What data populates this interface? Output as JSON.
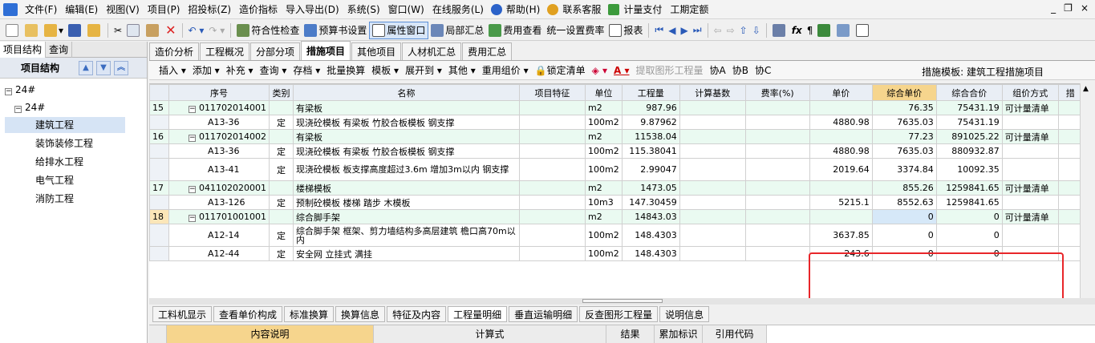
{
  "menu": [
    "文件(F)",
    "编辑(E)",
    "视图(V)",
    "项目(P)",
    "招投标(Z)",
    "造价指标",
    "导入导出(D)",
    "系统(S)",
    "窗口(W)",
    "在线服务(L)",
    "帮助(H)",
    "联系客服",
    "计量支付",
    "工期定额"
  ],
  "window_controls": [
    "_",
    "❐",
    "×"
  ],
  "toolbar": {
    "compliance_check": "符合性检查",
    "budget_settings": "预算书设置",
    "property_window": "属性窗口",
    "partial_summary": "局部汇总",
    "fee_view": "费用查看",
    "unified_rate": "统一设置费率",
    "report": "报表"
  },
  "left_panel": {
    "tabs": [
      "项目结构",
      "查询"
    ],
    "header": "项目结构",
    "tree": [
      {
        "label": "24#",
        "level": 0,
        "box": "−"
      },
      {
        "label": "24#",
        "level": 1,
        "box": "−"
      },
      {
        "label": "建筑工程",
        "level": 2,
        "selected": true
      },
      {
        "label": "装饰装修工程",
        "level": 2
      },
      {
        "label": "给排水工程",
        "level": 2
      },
      {
        "label": "电气工程",
        "level": 2
      },
      {
        "label": "消防工程",
        "level": 2
      }
    ]
  },
  "main_tabs": [
    "造价分析",
    "工程概况",
    "分部分项",
    "措施项目",
    "其他项目",
    "人材机汇总",
    "费用汇总"
  ],
  "active_main_tab": "措施项目",
  "tools": [
    "插入 ▾",
    "添加 ▾",
    "补充 ▾",
    "查询 ▾",
    "存档 ▾",
    "批量换算",
    "模板 ▾",
    "展开到 ▾",
    "其他 ▾",
    "重用组价 ▾",
    "锁定清单",
    "提取图形工程量",
    "协A",
    "协B",
    "协C"
  ],
  "template_label": "措施模板: 建筑工程措施项目",
  "columns": [
    "",
    "序号",
    "类别",
    "名称",
    "项目特征",
    "单位",
    "工程量",
    "计算基数",
    "费率(%)",
    "单价",
    "综合单价",
    "综合合价",
    "组价方式",
    "措"
  ],
  "rows": [
    {
      "rn": "15",
      "code": "011702014001",
      "box": true,
      "type": "",
      "name": "有梁板",
      "unit": "m2",
      "qty": "987.96",
      "price": "",
      "uprice": "76.35",
      "total": "75431.19",
      "method": "可计量清单",
      "parent": true
    },
    {
      "rn": "",
      "code": "A13-36",
      "type": "定",
      "name": "现浇砼模板 有梁板 竹胶合板模板 钢支撑",
      "unit": "100m2",
      "qty": "9.87962",
      "price": "4880.98",
      "uprice": "7635.03",
      "total": "75431.19",
      "method": ""
    },
    {
      "rn": "16",
      "code": "011702014002",
      "box": true,
      "type": "",
      "name": "有梁板",
      "unit": "m2",
      "qty": "11538.04",
      "price": "",
      "uprice": "77.23",
      "total": "891025.22",
      "method": "可计量清单",
      "parent": true
    },
    {
      "rn": "",
      "code": "A13-36",
      "type": "定",
      "name": "现浇砼模板 有梁板 竹胶合板模板 钢支撑",
      "unit": "100m2",
      "qty": "115.38041",
      "price": "4880.98",
      "uprice": "7635.03",
      "total": "880932.87",
      "method": ""
    },
    {
      "rn": "",
      "code": "A13-41",
      "type": "定",
      "name": "现浇砼模板 板支撑高度超过3.6m 增加3m以内 钢支撑",
      "unit": "100m2",
      "qty": "2.99047",
      "price": "2019.64",
      "uprice": "3374.84",
      "total": "10092.35",
      "method": "",
      "tall": true
    },
    {
      "rn": "17",
      "code": "041102020001",
      "box": true,
      "type": "",
      "name": "楼梯模板",
      "unit": "m2",
      "qty": "1473.05",
      "price": "",
      "uprice": "855.26",
      "total": "1259841.65",
      "method": "可计量清单",
      "parent": true
    },
    {
      "rn": "",
      "code": "A13-126",
      "type": "定",
      "name": "预制砼模板 楼梯 踏步 木模板",
      "unit": "10m3",
      "qty": "147.30459",
      "price": "5215.1",
      "uprice": "8552.63",
      "total": "1259841.65",
      "method": ""
    },
    {
      "rn": "18",
      "code": "011701001001",
      "box": true,
      "type": "",
      "name": "综合脚手架",
      "unit": "m2",
      "qty": "14843.03",
      "price": "",
      "uprice": "0",
      "total": "0",
      "method": "可计量清单",
      "parent": true,
      "current": true
    },
    {
      "rn": "",
      "code": "A12-14",
      "type": "定",
      "name": "综合脚手架 框架、剪力墙结构多高层建筑 檐口高70m以内",
      "unit": "100m2",
      "qty": "148.4303",
      "price": "3637.85",
      "uprice": "0",
      "total": "0",
      "method": "",
      "tall": true
    },
    {
      "rn": "",
      "code": "A12-44",
      "type": "定",
      "name": "安全网 立挂式 满挂",
      "unit": "100m2",
      "qty": "148.4303",
      "price": "243.6",
      "uprice": "0",
      "total": "0",
      "method": ""
    }
  ],
  "bottom_tabs": [
    "工料机显示",
    "查看单价构成",
    "标准换算",
    "换算信息",
    "特征及内容",
    "工程量明细",
    "垂直运输明细",
    "反查图形工程量",
    "说明信息"
  ],
  "active_bottom_tab": "工程量明细",
  "sub_columns": [
    "内容说明",
    "计算式",
    "结果",
    "累加标识",
    "引用代码"
  ]
}
